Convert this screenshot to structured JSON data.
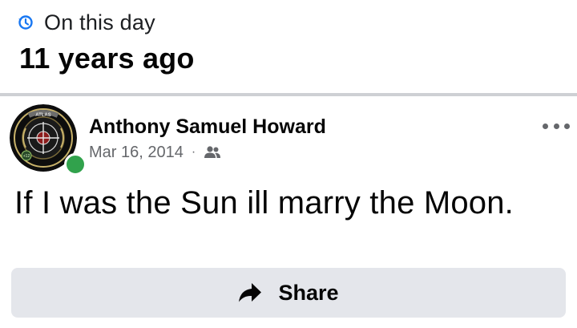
{
  "memory": {
    "label": "On this day",
    "years_ago": "11 years ago"
  },
  "post": {
    "author": "Anthony Samuel Howard",
    "date": "Mar 16, 2014",
    "separator": "·",
    "audience_icon": "friends-icon",
    "text": "If I was the Sun ill marry the Moon.",
    "presence_status": "online",
    "avatar_label": "ATLAS",
    "avatar_badge": "+12"
  },
  "actions": {
    "share_label": "Share",
    "share_icon": "share-arrow-icon",
    "more_icon": "more-options-icon"
  },
  "colors": {
    "accent": "#1877f2",
    "presence": "#31a24c",
    "secondary_text": "#65676b",
    "button_bg": "#e4e6eb",
    "divider": "#ced0d4"
  }
}
